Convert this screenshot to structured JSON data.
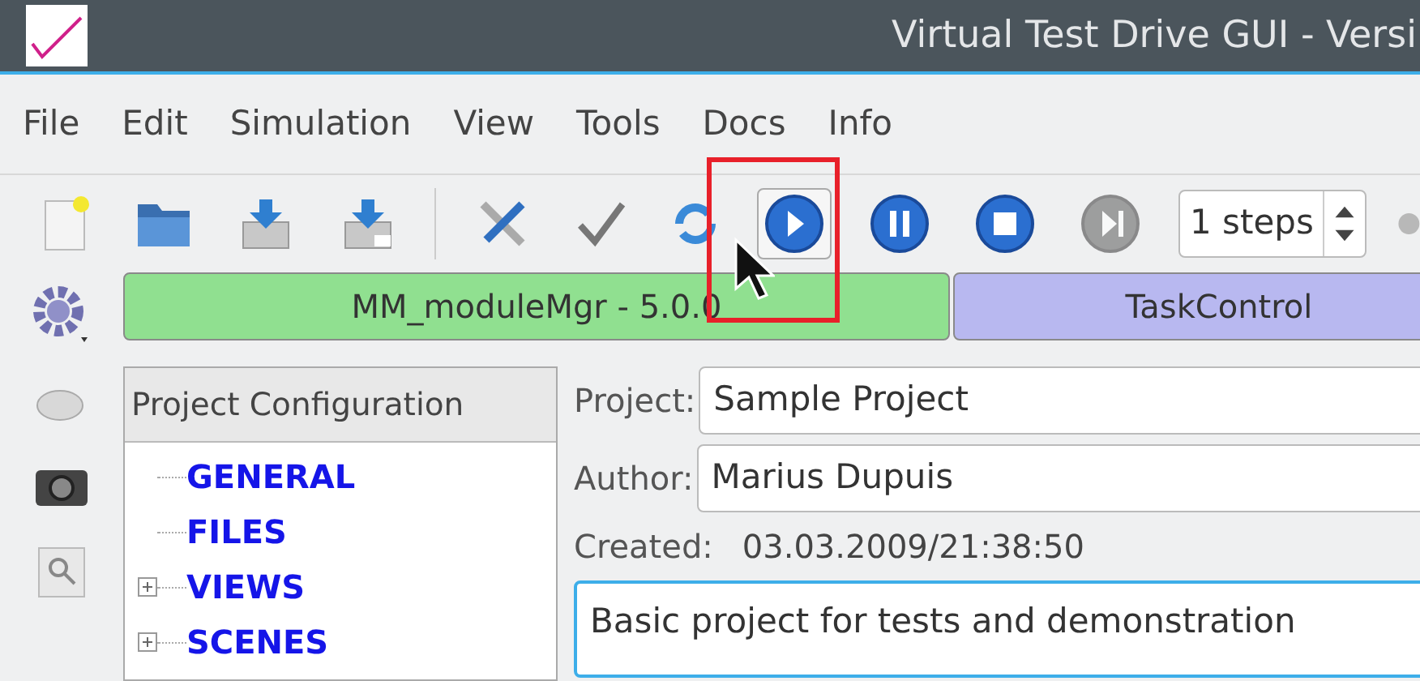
{
  "window": {
    "title": "Virtual Test Drive GUI - Versi"
  },
  "menu": [
    "File",
    "Edit",
    "Simulation",
    "View",
    "Tools",
    "Docs",
    "Info"
  ],
  "toolbar": [
    [
      {
        "kind": "new",
        "pressed": false,
        "disabled": false
      },
      {
        "kind": "open",
        "pressed": false,
        "disabled": false
      },
      {
        "kind": "save",
        "pressed": false,
        "disabled": false
      },
      {
        "kind": "saveas",
        "pressed": false,
        "disabled": false
      }
    ],
    [
      {
        "kind": "tools",
        "pressed": false,
        "disabled": false
      },
      {
        "kind": "check",
        "pressed": false,
        "disabled": false
      },
      {
        "kind": "refresh",
        "pressed": false,
        "disabled": false
      },
      {
        "kind": "play",
        "pressed": true,
        "disabled": false
      },
      {
        "kind": "pause",
        "pressed": false,
        "disabled": false
      },
      {
        "kind": "stop",
        "pressed": false,
        "disabled": false
      },
      {
        "kind": "step",
        "pressed": false,
        "disabled": true
      }
    ]
  ],
  "steps": {
    "value": "1 steps"
  },
  "modules": [
    {
      "label": "MM_moduleMgr - 5.0.0",
      "color": "#90e090"
    },
    {
      "label": "TaskControl",
      "color": "#b8b8f0"
    }
  ],
  "tree": {
    "header": "Project Configuration",
    "items": [
      {
        "label": "GENERAL",
        "kind": "leaf"
      },
      {
        "label": "FILES",
        "kind": "leaf"
      },
      {
        "label": "VIEWS",
        "kind": "branch",
        "expanded": false
      },
      {
        "label": "SCENES",
        "kind": "branch",
        "expanded": false
      }
    ]
  },
  "form": {
    "project_label": "Project:",
    "project": "Sample Project",
    "author_label": "Author:",
    "author": "Marius Dupuis",
    "created_label": "Created:",
    "created": "03.03.2009/21:38:50",
    "description": "Basic project for tests and demonstration"
  }
}
